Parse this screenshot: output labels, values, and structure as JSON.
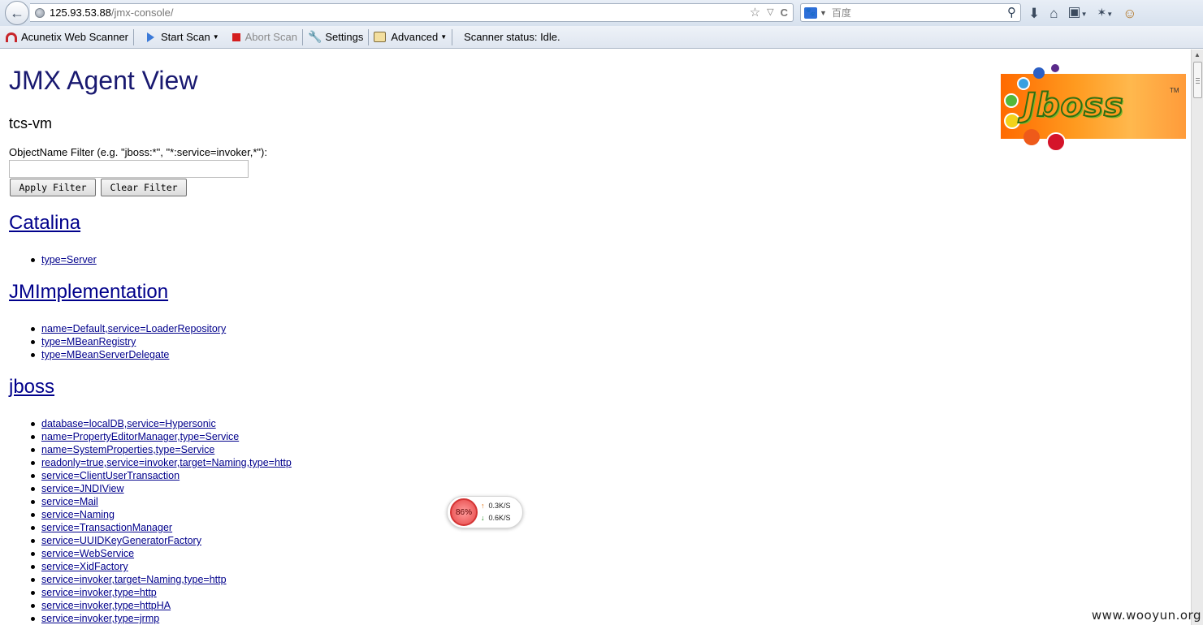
{
  "browser": {
    "url_host": "125.93.53.88",
    "url_path": "/jmx-console/",
    "search_placeholder": "百度",
    "baidu_icon_text": "🐾",
    "star_glyph": "☆",
    "history_glyph": "▽",
    "reload_glyph": "C"
  },
  "scanner_toolbar": {
    "name": "Acunetix Web Scanner",
    "start_scan": "Start Scan",
    "abort_scan": "Abort Scan",
    "settings": "Settings",
    "advanced": "Advanced",
    "status": "Scanner status: Idle."
  },
  "page": {
    "title": "JMX Agent View",
    "host": "tcs-vm",
    "filter_label": "ObjectName Filter (e.g. \"jboss:*\", \"*:service=invoker,*\"):",
    "filter_value": "",
    "apply_filter": "Apply Filter",
    "clear_filter": "Clear Filter",
    "logo_text": "Jboss",
    "logo_tm": "TM"
  },
  "domains": [
    {
      "name": "Catalina",
      "mbeans": [
        "type=Server"
      ]
    },
    {
      "name": "JMImplementation",
      "mbeans": [
        "name=Default,service=LoaderRepository",
        "type=MBeanRegistry",
        "type=MBeanServerDelegate"
      ]
    },
    {
      "name": "jboss",
      "mbeans": [
        "database=localDB,service=Hypersonic",
        "name=PropertyEditorManager,type=Service",
        "name=SystemProperties,type=Service",
        "readonly=true,service=invoker,target=Naming,type=http",
        "service=ClientUserTransaction",
        "service=JNDIView",
        "service=Mail",
        "service=Naming",
        "service=TransactionManager",
        "service=UUIDKeyGeneratorFactory",
        "service=WebService",
        "service=XidFactory",
        "service=invoker,target=Naming,type=http",
        "service=invoker,type=http",
        "service=invoker,type=httpHA",
        "service=invoker,type=jrmp"
      ]
    }
  ],
  "speed_widget": {
    "percent": "86%",
    "upload": "0.3K/S",
    "download": "0.6K/S"
  },
  "watermark": "www.wooyun.org",
  "colors": {
    "title": "#191970",
    "link": "#00008b"
  }
}
